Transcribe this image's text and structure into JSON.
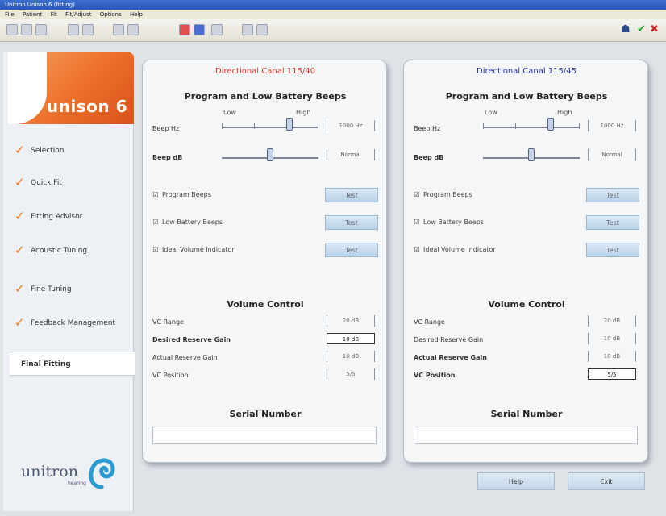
{
  "window": {
    "title": "Unitron Unison 6 (fitting)"
  },
  "menu": [
    "File",
    "Patient",
    "Fit",
    "Fit/Adjust",
    "Options",
    "Help"
  ],
  "sidebar": {
    "brand": "unison 6",
    "items": [
      {
        "label": "Selection",
        "done": true
      },
      {
        "label": "Quick Fit",
        "done": true
      },
      {
        "label": "Fitting Advisor",
        "done": true
      },
      {
        "label": "Acoustic Tuning",
        "done": true
      },
      {
        "label": "Fine Tuning",
        "done": true
      },
      {
        "label": "Feedback Management",
        "done": true
      },
      {
        "label": "Final Fitting",
        "done": false,
        "active": true
      }
    ],
    "footer_logo": "unitron",
    "footer_tagline": "hearing"
  },
  "panels": [
    {
      "title": "Directional Canal 115/40",
      "title_color": "#d63a2a",
      "beeps_title": "Program and Low Battery Beeps",
      "low_label": "Low",
      "high_label": "High",
      "beep_hz": {
        "label": "Beep Hz",
        "value": "1000 Hz",
        "level": 0.7
      },
      "beep_db": {
        "label": "Beep dB",
        "value": "Normal",
        "level": 0.5
      },
      "checks": [
        {
          "label": "Program Beeps",
          "test": "Test"
        },
        {
          "label": "Low Battery Beeps",
          "test": "Test"
        },
        {
          "label": "Ideal Volume Indicator",
          "test": "Test"
        }
      ],
      "volume_title": "Volume Control",
      "volume_rows": [
        {
          "label": "VC Range",
          "value": "20 dB",
          "bold": false,
          "boxed": false
        },
        {
          "label": "Desired Reserve Gain",
          "value": "10 dB",
          "bold": true,
          "boxed": true
        },
        {
          "label": "Actual Reserve Gain",
          "value": "10 dB",
          "bold": false,
          "boxed": false
        },
        {
          "label": "VC Position",
          "value": "5/5",
          "bold": false,
          "boxed": false
        }
      ],
      "serial_title": "Serial Number"
    },
    {
      "title": "Directional Canal 115/45",
      "title_color": "#2b36a8",
      "beeps_title": "Program and Low Battery Beeps",
      "low_label": "Low",
      "high_label": "High",
      "beep_hz": {
        "label": "Beep Hz",
        "value": "1000 Hz",
        "level": 0.7
      },
      "beep_db": {
        "label": "Beep dB",
        "value": "Normal",
        "level": 0.5
      },
      "checks": [
        {
          "label": "Program Beeps",
          "test": "Test"
        },
        {
          "label": "Low Battery Beeps",
          "test": "Test"
        },
        {
          "label": "Ideal Volume Indicator",
          "test": "Test"
        }
      ],
      "volume_title": "Volume Control",
      "volume_rows": [
        {
          "label": "VC Range",
          "value": "20 dB",
          "bold": false,
          "boxed": false
        },
        {
          "label": "Desired Reserve Gain",
          "value": "10 dB",
          "bold": false,
          "boxed": false
        },
        {
          "label": "Actual Reserve Gain",
          "value": "10 dB",
          "bold": true,
          "boxed": false
        },
        {
          "label": "VC Position",
          "value": "5/5",
          "bold": true,
          "boxed": true
        }
      ],
      "serial_title": "Serial Number"
    }
  ],
  "buttons": {
    "help": "Help",
    "exit": "Exit"
  }
}
